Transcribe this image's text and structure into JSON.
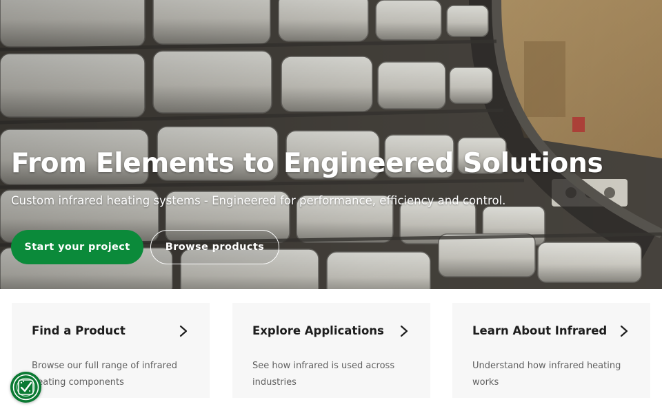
{
  "hero": {
    "title": "From Elements to Engineered Solutions",
    "subtitle": "Custom infrared heating systems - Engineered for performance, efficiency and control.",
    "primary_button": "Start your project",
    "secondary_button": "Browse products",
    "background": "infrared-heater-elements-photo"
  },
  "cards": [
    {
      "title": "Find a Product",
      "description": "Browse our full range of infrared heating components",
      "icon": "chevron-right-icon"
    },
    {
      "title": "Explore Applications",
      "description": "See how infrared is used across industries",
      "icon": "chevron-right-icon"
    },
    {
      "title": "Learn About Infrared",
      "description": "Understand how infrared heating works",
      "icon": "chevron-right-icon"
    }
  ],
  "privacy_widget": {
    "icon": "cookie-consent-icon"
  },
  "colors": {
    "accent": "#0b8a3a",
    "card_background": "#f7f7f7",
    "title_text": "#1d1d1d",
    "body_text": "#5f5f5f"
  }
}
